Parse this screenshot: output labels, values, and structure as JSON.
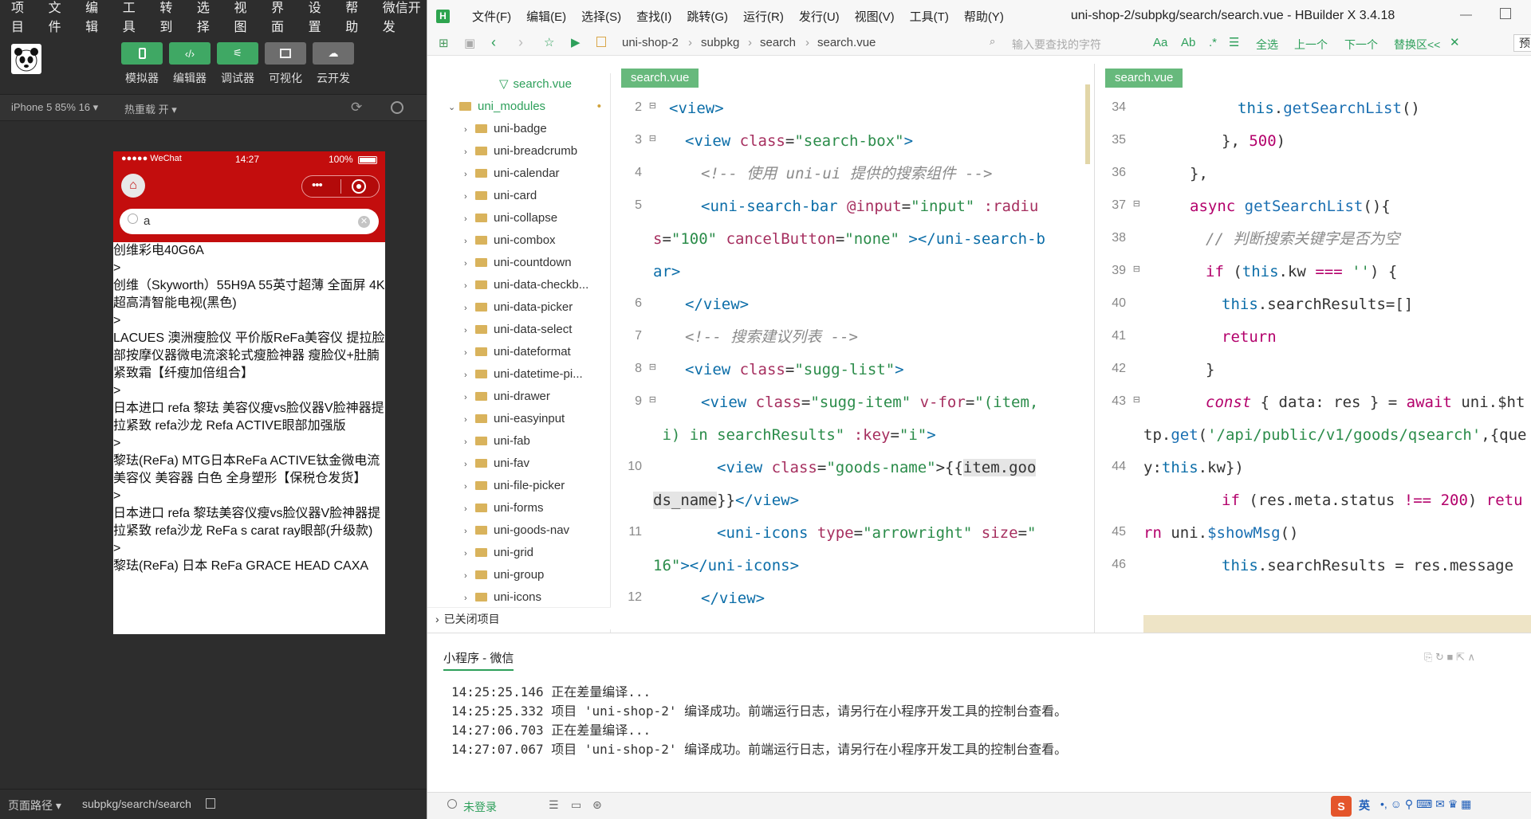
{
  "sim": {
    "menu": [
      "项目",
      "文件",
      "编辑",
      "工具",
      "转到",
      "选择",
      "视图",
      "界面",
      "设置",
      "帮助",
      "微信开发"
    ],
    "tool_buttons": [
      "模拟器",
      "编辑器",
      "调试器",
      "可视化",
      "云开发"
    ],
    "device": "iPhone 5 85% 16",
    "hot_reload": "热重载 开",
    "phone": {
      "carrier": "●●●●● WeChat",
      "time": "14:27",
      "battery": "100%",
      "search_value": "a",
      "suggestions": [
        "创维彩电40G6A",
        "创维（Skyworth）55H9A 55英寸超薄 全面屏 4K超高清智能电视(黑色)",
        "LACUES 澳洲瘦脸仪 平价版ReFa美容仪 提拉脸部按摩仪器微电流滚轮式瘦脸神器 瘦脸仪+肚腩紧致霜【纤瘦加倍组合】",
        "日本进口 refa 黎珐 美容仪瘦vs脸仪器V脸神器提拉紧致 refa沙龙 Refa ACTIVE眼部加强版",
        "黎珐(ReFa) MTG日本ReFa ACTIVE钛金微电流美容仪 美容器 白色 全身塑形【保税仓发货】",
        "日本进口 refa 黎珐美容仪瘦vs脸仪器V脸神器提拉紧致 refa沙龙 ReFa s carat ray眼部(升级款)",
        "黎珐(ReFa) 日本 ReFa GRACE HEAD CAXA"
      ],
      "arrow": ">"
    },
    "page_path_label": "页面路径",
    "page_path": "subpkg/search/search"
  },
  "editor": {
    "menu": [
      "文件(F)",
      "编辑(E)",
      "选择(S)",
      "查找(I)",
      "跳转(G)",
      "运行(R)",
      "发行(U)",
      "视图(V)",
      "工具(T)",
      "帮助(Y)"
    ],
    "title": "uni-shop-2/subpkg/search/search.vue - HBuilder X 3.4.18",
    "breadcrumb": [
      "uni-shop-2",
      "subpkg",
      "search",
      "search.vue"
    ],
    "find_placeholder": "输入要查找的字符",
    "find_actions": [
      "全选",
      "上一个",
      "下一个",
      "替换区<<"
    ],
    "preview_label": "预",
    "tree": {
      "active_file": "search.vue",
      "folder": "uni_modules",
      "items": [
        "uni-badge",
        "uni-breadcrumb",
        "uni-calendar",
        "uni-card",
        "uni-collapse",
        "uni-combox",
        "uni-countdown",
        "uni-data-checkb...",
        "uni-data-picker",
        "uni-data-select",
        "uni-dateformat",
        "uni-datetime-pi...",
        "uni-drawer",
        "uni-easyinput",
        "uni-fab",
        "uni-fav",
        "uni-file-picker",
        "uni-forms",
        "uni-goods-nav",
        "uni-grid",
        "uni-group",
        "uni-icons"
      ],
      "closed_projects": "已关闭项目"
    },
    "left_tab": "search.vue",
    "right_tab": "search.vue",
    "left_line_numbers": [
      "2",
      "3",
      "4",
      "5",
      "",
      "",
      "6",
      "7",
      "8",
      "9",
      "",
      "10",
      "",
      "11",
      "",
      "12"
    ],
    "right_line_numbers": [
      "34",
      "35",
      "36",
      "37",
      "38",
      "39",
      "40",
      "41",
      "42",
      "43",
      "",
      "44",
      "",
      "45",
      "46"
    ],
    "console": {
      "tab": "小程序 - 微信",
      "lines": [
        "14:25:25.146 正在差量编译...",
        "14:25:25.332 项目 'uni-shop-2' 编译成功。前端运行日志，请另行在小程序开发工具的控制台查看。",
        "14:27:06.703 正在差量编译...",
        "14:27:07.067 项目 'uni-shop-2' 编译成功。前端运行日志，请另行在小程序开发工具的控制台查看。"
      ]
    },
    "status": {
      "login": "未登录"
    },
    "ime_label": "英"
  }
}
